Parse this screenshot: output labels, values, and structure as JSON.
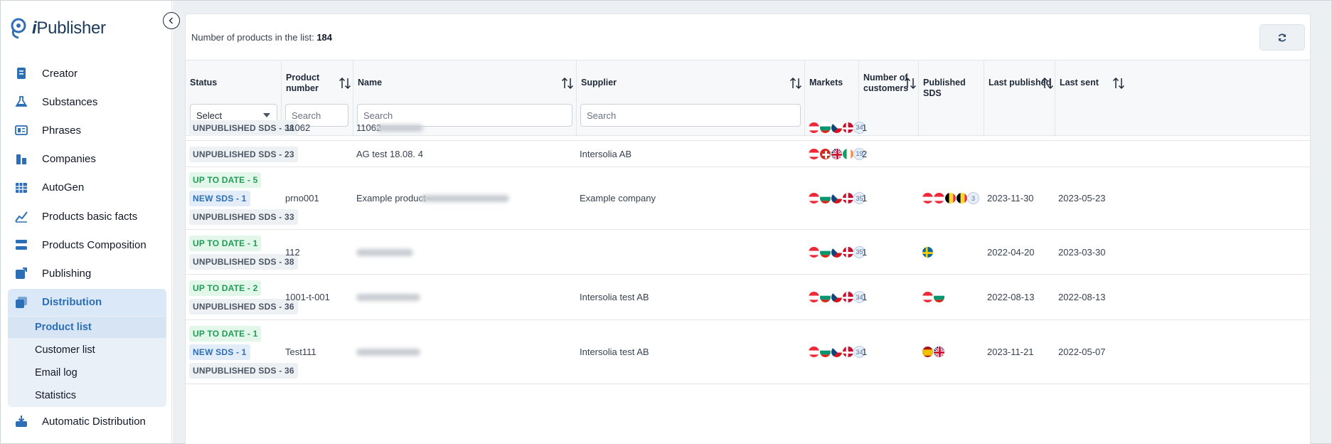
{
  "app": {
    "brand_prefix": "i",
    "brand_name": "Publisher"
  },
  "sidebar": {
    "items": [
      {
        "label": "Creator",
        "icon": "document-icon"
      },
      {
        "label": "Substances",
        "icon": "flask-icon"
      },
      {
        "label": "Phrases",
        "icon": "book-icon"
      },
      {
        "label": "Companies",
        "icon": "building-icon"
      },
      {
        "label": "AutoGen",
        "icon": "grid-icon"
      },
      {
        "label": "Products basic facts",
        "icon": "chart-icon"
      },
      {
        "label": "Products Composition",
        "icon": "layers-icon"
      },
      {
        "label": "Publishing",
        "icon": "publish-icon"
      },
      {
        "label": "Distribution",
        "icon": "distribution-icon"
      }
    ],
    "subitems": [
      "Product list",
      "Customer list",
      "Email log",
      "Statistics"
    ],
    "bottom_item": {
      "label": "Automatic Distribution",
      "icon": "inbox-icon"
    }
  },
  "toolbar": {
    "count_label": "Number of products in the list:",
    "count_value": "184"
  },
  "table": {
    "columns": {
      "status": "Status",
      "product_number_1": "Product",
      "product_number_2": "number",
      "name": "Name",
      "supplier": "Supplier",
      "markets": "Markets",
      "customers_1": "Number of",
      "customers_2": "customers",
      "published_sds": "Published SDS",
      "last_published": "Last published",
      "last_sent": "Last sent"
    },
    "filters": {
      "status_select": "Select",
      "search_placeholder": "Search"
    },
    "rows": [
      {
        "badges": [
          {
            "text": "UNPUBLISHED SDS - 38",
            "kind": "unp"
          }
        ],
        "product_number": "11062",
        "name": "11062",
        "supplier": "",
        "markets": [
          "at",
          "bg",
          "cz",
          "dk"
        ],
        "markets_more": "34",
        "customers": "1",
        "published": [],
        "published_more": "",
        "last_published": "",
        "last_sent": ""
      },
      {
        "badges": [
          {
            "text": "UNPUBLISHED SDS - 23",
            "kind": "unp"
          }
        ],
        "product_number": "",
        "name": "AG test 18.08. 4",
        "supplier": "Intersolia AB",
        "markets": [
          "at",
          "ch",
          "gb",
          "ie"
        ],
        "markets_more": "19",
        "customers": "2",
        "published": [],
        "published_more": "",
        "last_published": "",
        "last_sent": ""
      },
      {
        "badges": [
          {
            "text": "UP TO DATE - 5",
            "kind": "up"
          },
          {
            "text": "NEW SDS - 1",
            "kind": "new"
          },
          {
            "text": "UNPUBLISHED SDS - 33",
            "kind": "unp"
          }
        ],
        "product_number": "prno001",
        "name": "Example product -",
        "supplier": "Example company",
        "markets": [
          "at",
          "bg",
          "cz",
          "dk"
        ],
        "markets_more": "35",
        "customers": "1",
        "published": [
          "at",
          "at",
          "be",
          "be"
        ],
        "published_more": "3",
        "last_published": "2023-11-30",
        "last_sent": "2023-05-23"
      },
      {
        "badges": [
          {
            "text": "UP TO DATE - 1",
            "kind": "up"
          },
          {
            "text": "UNPUBLISHED SDS - 38",
            "kind": "unp"
          }
        ],
        "product_number": "112",
        "name": "",
        "supplier": "",
        "markets": [
          "at",
          "bg",
          "cz",
          "dk"
        ],
        "markets_more": "35",
        "customers": "1",
        "published": [
          "se"
        ],
        "published_more": "",
        "last_published": "2022-04-20",
        "last_sent": "2023-03-30"
      },
      {
        "badges": [
          {
            "text": "UP TO DATE - 2",
            "kind": "up"
          },
          {
            "text": "UNPUBLISHED SDS - 36",
            "kind": "unp"
          }
        ],
        "product_number": "1001-t-001",
        "name": "",
        "supplier": "Intersolia test AB",
        "markets": [
          "at",
          "bg",
          "cz",
          "dk"
        ],
        "markets_more": "34",
        "customers": "1",
        "published": [
          "at",
          "bg"
        ],
        "published_more": "",
        "last_published": "2022-08-13",
        "last_sent": "2022-08-13"
      },
      {
        "badges": [
          {
            "text": "UP TO DATE - 1",
            "kind": "up"
          },
          {
            "text": "NEW SDS - 1",
            "kind": "new"
          },
          {
            "text": "UNPUBLISHED SDS - 36",
            "kind": "unp"
          }
        ],
        "product_number": "Test111",
        "name": "",
        "supplier": "Intersolia test AB",
        "markets": [
          "at",
          "bg",
          "cz",
          "dk"
        ],
        "markets_more": "34",
        "customers": "1",
        "published": [
          "es",
          "gb"
        ],
        "published_more": "",
        "last_published": "2023-11-21",
        "last_sent": "2022-05-07"
      }
    ]
  },
  "colors": {
    "accent": "#2c6fb7",
    "up_to_date": "#1f9d55",
    "unpublished": "#4b5563"
  }
}
